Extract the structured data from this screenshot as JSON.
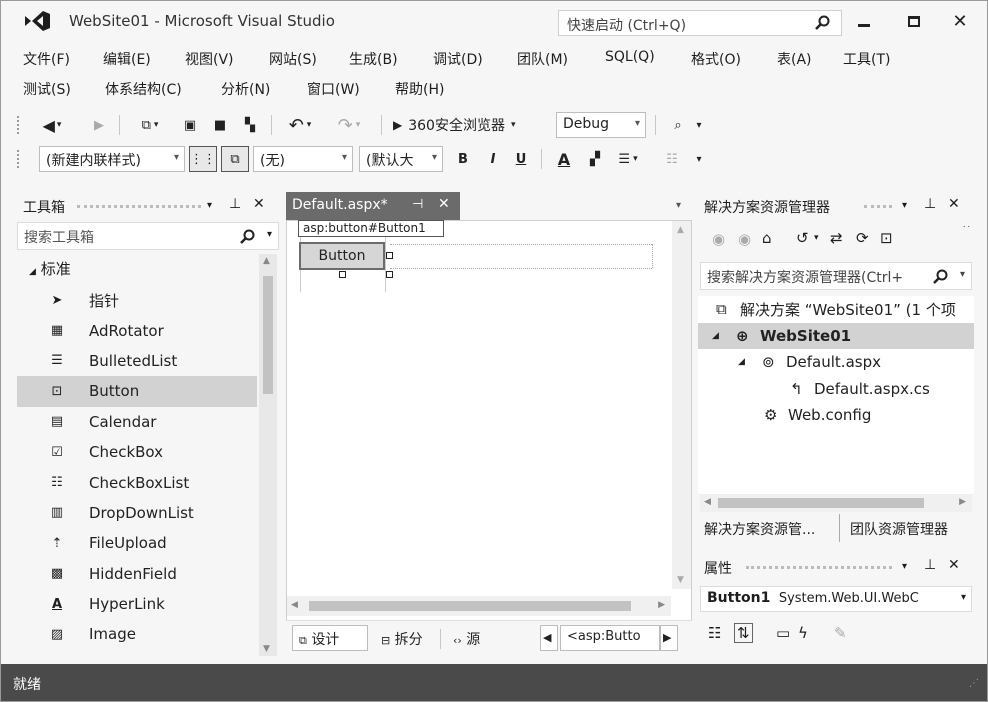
{
  "window": {
    "title": "WebSite01 - Microsoft Visual Studio",
    "quick_launch": "快速启动 (Ctrl+Q)"
  },
  "menu_row1": [
    "文件(F)",
    "编辑(E)",
    "视图(V)",
    "网站(S)",
    "生成(B)",
    "调试(D)",
    "团队(M)",
    "SQL(Q)",
    "格式(O)",
    "表(A)",
    "工具(T)"
  ],
  "menu_row2": [
    "测试(S)",
    "体系结构(C)",
    "分析(N)",
    "窗口(W)",
    "帮助(H)"
  ],
  "toolbar1": {
    "browser": "360安全浏览器",
    "config": "Debug"
  },
  "toolbar2": {
    "style_combo": "(新建内联样式)",
    "block_combo": "(无)",
    "font_combo": "(默认大",
    "bold": "B",
    "italic": "I",
    "underline": "U",
    "font_a": "A"
  },
  "toolbox": {
    "title": "工具箱",
    "search_placeholder": "搜索工具箱",
    "group": "标准",
    "items": [
      "指针",
      "AdRotator",
      "BulletedList",
      "Button",
      "Calendar",
      "CheckBox",
      "CheckBoxList",
      "DropDownList",
      "FileUpload",
      "HiddenField",
      "HyperLink",
      "Image"
    ],
    "selected_index": 3,
    "icons": [
      "pointer-icon",
      "adrotator-icon",
      "bulleted-list-icon",
      "button-control-icon",
      "calendar-icon",
      "checkbox-icon",
      "checkbox-list-icon",
      "dropdown-list-icon",
      "file-upload-icon",
      "hidden-field-icon",
      "hyperlink-icon",
      "image-icon"
    ]
  },
  "editor": {
    "tab": "Default.aspx*",
    "tag_label": "asp:button#Button1",
    "button_text": "Button",
    "views": [
      "设计",
      "拆分",
      "源"
    ],
    "tag_nav": "<asp:Butto"
  },
  "solution_explorer": {
    "title": "解决方案资源管理器",
    "search_placeholder": "搜索解决方案资源管理器(Ctrl+",
    "tree": [
      {
        "label": "解决方案 “WebSite01” (1 个项",
        "level": 0,
        "icon": "solution-icon"
      },
      {
        "label": "WebSite01",
        "level": 1,
        "icon": "website-globe-icon",
        "selected": true
      },
      {
        "label": "Default.aspx",
        "level": 2,
        "icon": "aspx-page-icon"
      },
      {
        "label": "Default.aspx.cs",
        "level": 3,
        "icon": "cs-file-icon"
      },
      {
        "label": "Web.config",
        "level": 2,
        "icon": "config-file-icon"
      }
    ],
    "bottom_tabs": [
      "解决方案资源管...",
      "团队资源管理器"
    ]
  },
  "properties": {
    "title": "属性",
    "selected_object_name": "Button1",
    "selected_object_type": "System.Web.UI.WebC"
  },
  "status": {
    "text": "就绪"
  }
}
